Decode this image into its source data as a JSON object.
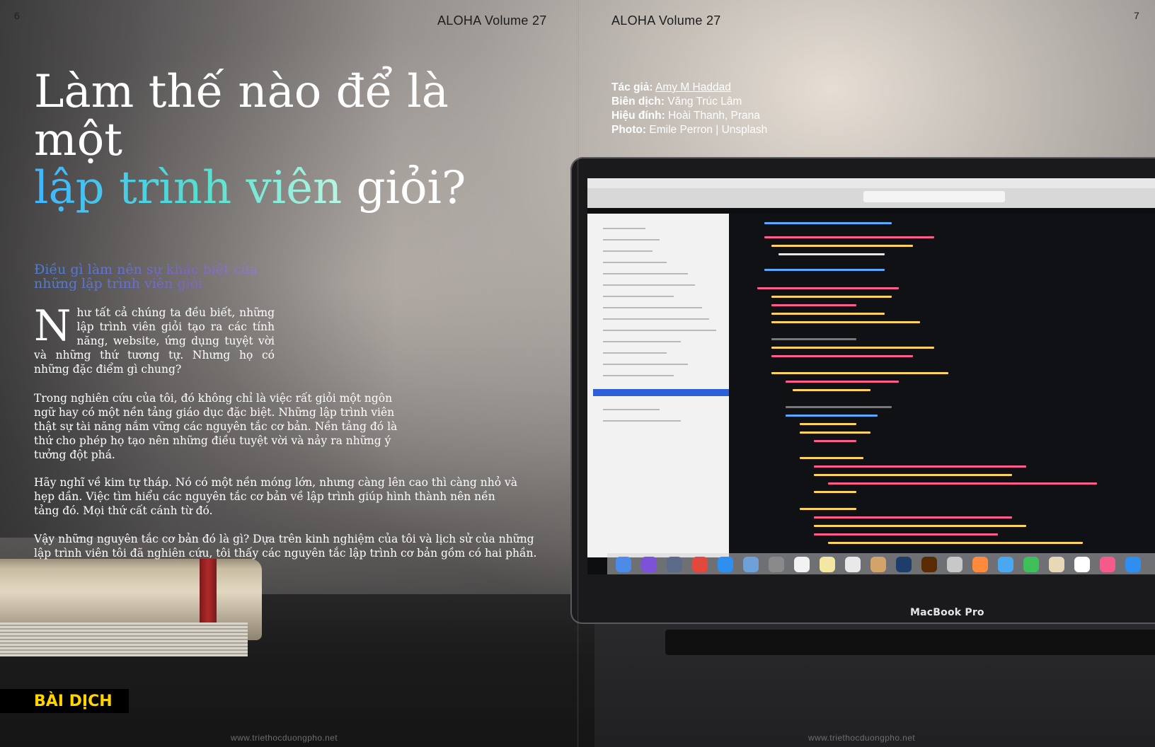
{
  "header": {
    "page_left": "6",
    "page_right": "7",
    "running_head_left": "ALOHA Volume 27",
    "running_head_right": "ALOHA Volume 27"
  },
  "article": {
    "title_line1": "Làm thế nào để là một",
    "title_gradient": "lập trình viên",
    "title_end": " giỏi?",
    "subheading": "Điều gì làm nên sự khác biệt của những lập trình viên giỏi",
    "drop_cap": "N",
    "paragraph1": "hư tất cả chúng ta đều biết, những lập trình viên giỏi tạo ra các tính năng, website, ứng dụng tuyệt vời và những thứ tương tự. Nhưng họ có những đặc điểm gì chung?",
    "paragraph2": "Trong nghiên cứu của tôi, đó không chỉ là việc rất giỏi một ngôn ngữ hay có một nền tảng giáo dục đặc biệt. Những lập trình viên thật sự tài năng nắm vững các nguyên tắc cơ bản. Nền tảng đó là thứ cho phép họ tạo nên những điều tuyệt vời và nảy ra những ý tưởng đột phá.",
    "paragraph3": "Hãy nghĩ về kim tự tháp. Nó có một nền móng lớn, nhưng càng lên cao thì càng nhỏ và hẹp dần. Việc tìm hiểu các nguyên tắc cơ bản về lập trình giúp hình thành nên nền tảng đó. Mọi thứ cất cánh từ đó.",
    "paragraph4": "Vậy những nguyên tắc cơ bản đó là gì? Dựa trên kinh nghiệm của tôi và lịch sử của những lập trình viên tôi đã nghiên cứu, tôi thấy các nguyên tắc lập trình cơ bản gồm có hai phần."
  },
  "credits": {
    "author_label": "Tác giả:",
    "author": "Amy M Haddad",
    "translator_label": "Biên dịch:",
    "translator": "Văng Trúc Lâm",
    "editor_label": "Hiệu đính:",
    "editor": "Hoài Thanh, Prana",
    "photo_label": "Photo:",
    "photo": "Emile Perron | Unsplash"
  },
  "section_tag": "BÀI DỊCH",
  "footer": {
    "url_left": "www.triethocduongpho.net",
    "url_right": "www.triethocduongpho.net"
  },
  "photo": {
    "laptop_brand": "MacBook Pro"
  },
  "colors": {
    "accent_title_start": "#3fb4ff",
    "accent_title_end": "#b9f6e2",
    "subheading": "#6f6fd0",
    "tag_text": "#ffd400",
    "tag_bg": "#000000"
  }
}
